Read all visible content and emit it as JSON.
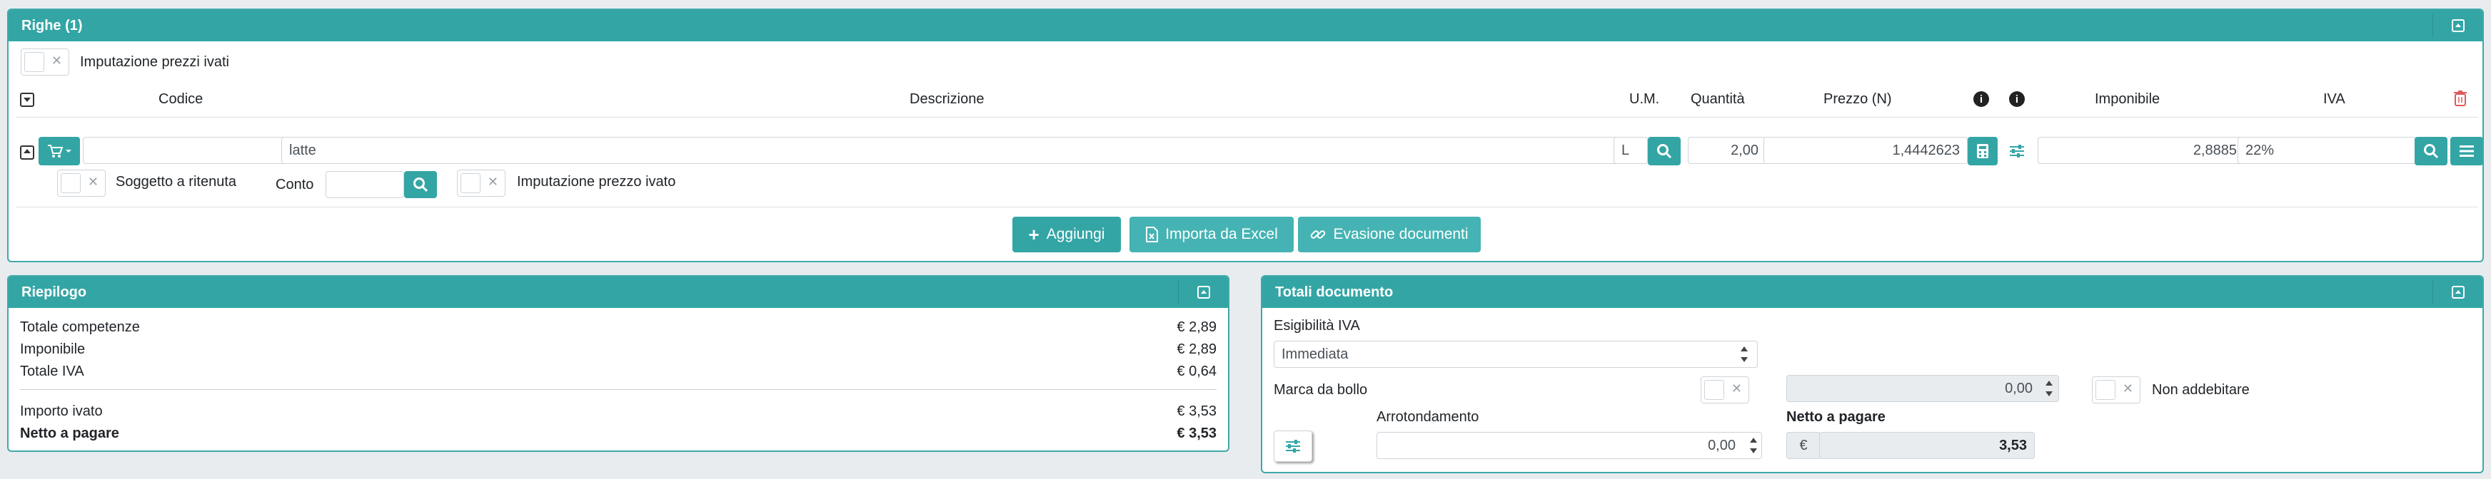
{
  "righe": {
    "title": "Righe (1)",
    "imputazione_prezzi_ivati": "Imputazione prezzi ivati",
    "headers": {
      "codice": "Codice",
      "descrizione": "Descrizione",
      "um": "U.M.",
      "quantita": "Quantità",
      "prezzo": "Prezzo (N)",
      "imponibile": "Imponibile",
      "iva": "IVA"
    },
    "row": {
      "descrizione": "latte",
      "um": "L",
      "quantita": "2,00",
      "prezzo": "1,4442623",
      "imponibile": "2,8885",
      "iva": "22%",
      "soggetto_ritenuta": "Soggetto a ritenuta",
      "conto_label": "Conto",
      "imputazione_prezzo_ivato": "Imputazione prezzo ivato"
    },
    "buttons": {
      "aggiungi": "Aggiungi",
      "importa_excel": "Importa da Excel",
      "evasione": "Evasione documenti"
    }
  },
  "riepilogo": {
    "title": "Riepilogo",
    "rows": [
      {
        "label": "Totale competenze",
        "value": "€ 2,89"
      },
      {
        "label": "Imponibile",
        "value": "€ 2,89"
      },
      {
        "label": "Totale IVA",
        "value": "€ 0,64"
      },
      {
        "label": "Importo ivato",
        "value": "€ 3,53"
      },
      {
        "label": "Netto a pagare",
        "value": "€ 3,53"
      }
    ]
  },
  "totali": {
    "title": "Totali documento",
    "esigibilita_label": "Esigibilità IVA",
    "esigibilita_value": "Immediata",
    "marca_bollo_label": "Marca da bollo",
    "marca_bollo_value": "0,00",
    "non_addebitare": "Non addebitare",
    "arrotondamento_label": "Arrotondamento",
    "arrotondamento_value": "0,00",
    "netto_label": "Netto a pagare",
    "netto_currency": "€",
    "netto_value": "3,53"
  },
  "colors": {
    "accent": "#34a5a5",
    "danger": "#e05a5a"
  }
}
